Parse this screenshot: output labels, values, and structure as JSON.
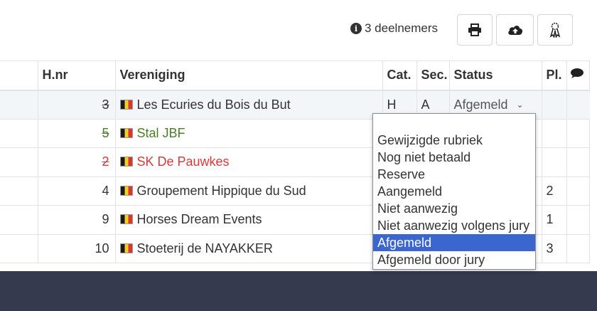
{
  "header": {
    "participants_text": "3 deelnemers",
    "info_icon": "info-circle-icon",
    "buttons": [
      {
        "icon": "print-icon"
      },
      {
        "icon": "cloud-upload-icon"
      },
      {
        "icon": "ribbon-icon"
      }
    ]
  },
  "table": {
    "columns": {
      "hnr": "H.nr",
      "vereniging": "Vereniging",
      "cat": "Cat.",
      "sec": "Sec.",
      "status": "Status",
      "pl": "Pl.",
      "comment_icon": "comment-icon"
    },
    "rows": [
      {
        "hnr": "3",
        "club": "Les Ecuries du Bois du But",
        "cat": "H",
        "sec": "A",
        "status": "Afgemeld",
        "pl": "",
        "hnr_strike": true,
        "color": "default"
      },
      {
        "hnr": "5",
        "club": "Stal JBF",
        "cat": "",
        "sec": "",
        "status": "",
        "pl": "",
        "hnr_strike": true,
        "color": "green"
      },
      {
        "hnr": "2",
        "club": "SK De Pauwkes",
        "cat": "",
        "sec": "",
        "status": "",
        "pl": "",
        "hnr_strike": true,
        "color": "red"
      },
      {
        "hnr": "4",
        "club": "Groupement Hippique du Sud",
        "cat": "",
        "sec": "",
        "status": "",
        "pl": "2",
        "hnr_strike": false,
        "color": "default"
      },
      {
        "hnr": "9",
        "club": "Horses Dream Events",
        "cat": "",
        "sec": "",
        "status": "",
        "pl": "1",
        "hnr_strike": false,
        "color": "default"
      },
      {
        "hnr": "10",
        "club": "Stoeterij de NAYAKKER",
        "cat": "",
        "sec": "",
        "status": "",
        "pl": "3",
        "hnr_strike": false,
        "color": "default"
      }
    ]
  },
  "status_dropdown": {
    "selected": "Afgemeld",
    "options": [
      "Gewijzigde rubriek",
      "Nog niet betaald",
      "Reserve",
      "Aangemeld",
      "Niet aanwezig",
      "Niet aanwezig volgens jury",
      "Afgemeld",
      "Afgemeld door jury"
    ]
  },
  "colors": {
    "green": "#4b7c26",
    "red": "#d9383a",
    "selected_option": "#3b66cf",
    "footer": "#363a4f"
  }
}
